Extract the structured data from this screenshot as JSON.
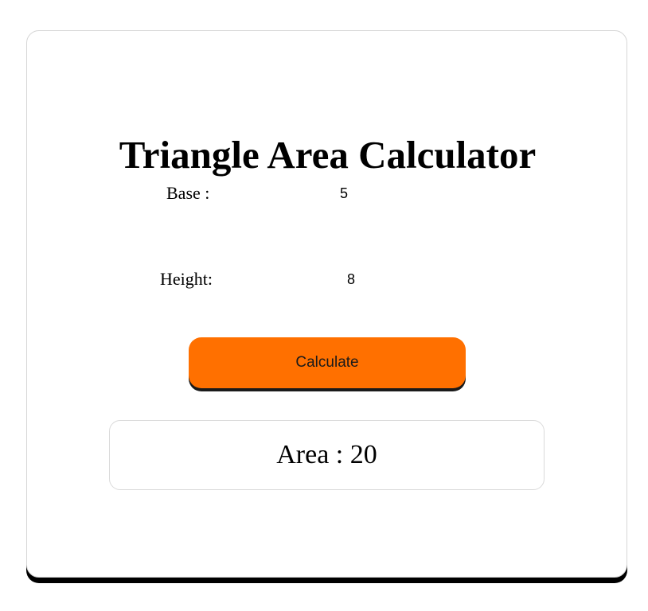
{
  "calculator": {
    "title": "Triangle Area Calculator",
    "base": {
      "label": "Base :",
      "value": "5"
    },
    "height": {
      "label": "Height:",
      "value": "8"
    },
    "calculate_label": "Calculate",
    "result": {
      "label": "Area :",
      "value": "20"
    }
  },
  "colors": {
    "button": "#ff7000",
    "shadow": "#000000",
    "border": "#d6d6d6"
  }
}
